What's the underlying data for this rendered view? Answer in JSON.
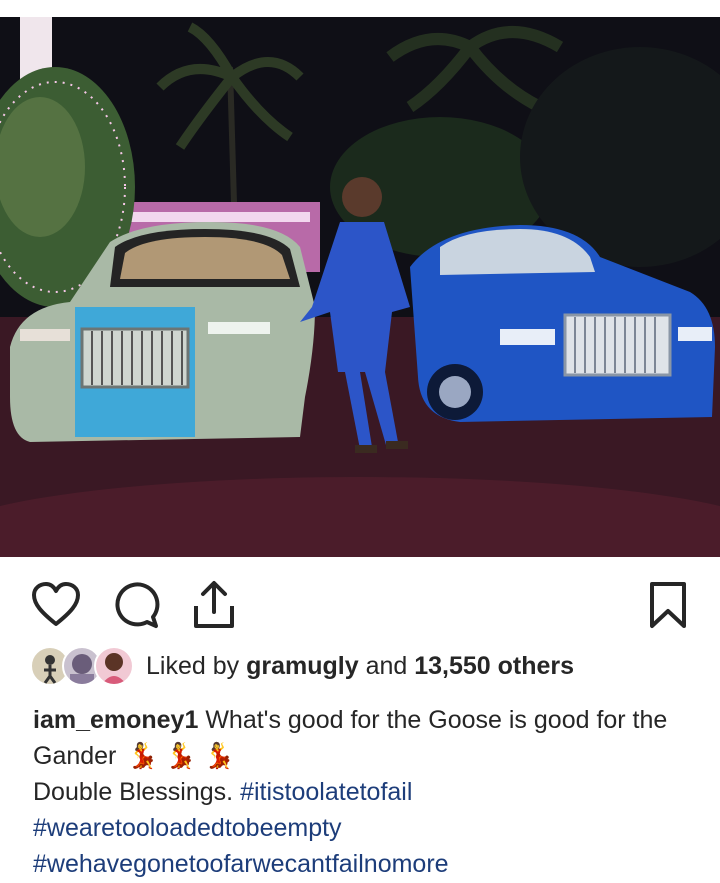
{
  "post": {
    "liked_by_prefix": "Liked by",
    "liked_by_user": "gramugly",
    "liked_by_and": "and",
    "liked_by_count": "13,550 others",
    "username": "iam_emoney1",
    "caption_text": "What's good for the Goose is good for the Gander",
    "caption_emojis": "💃 💃 💃",
    "caption_line2": "Double Blessings.",
    "hashtags": [
      "#itistoolatetofail",
      "#wearetooloadedtobeempty",
      "#wehavegonetoofarwecantfailnomore"
    ]
  },
  "icons": {
    "like": "heart-icon",
    "comment": "comment-bubble-icon",
    "share": "share-icon",
    "save": "bookmark-icon"
  },
  "colors": {
    "text": "#262626",
    "hashtag": "#1d3d7a",
    "background": "#ffffff"
  }
}
